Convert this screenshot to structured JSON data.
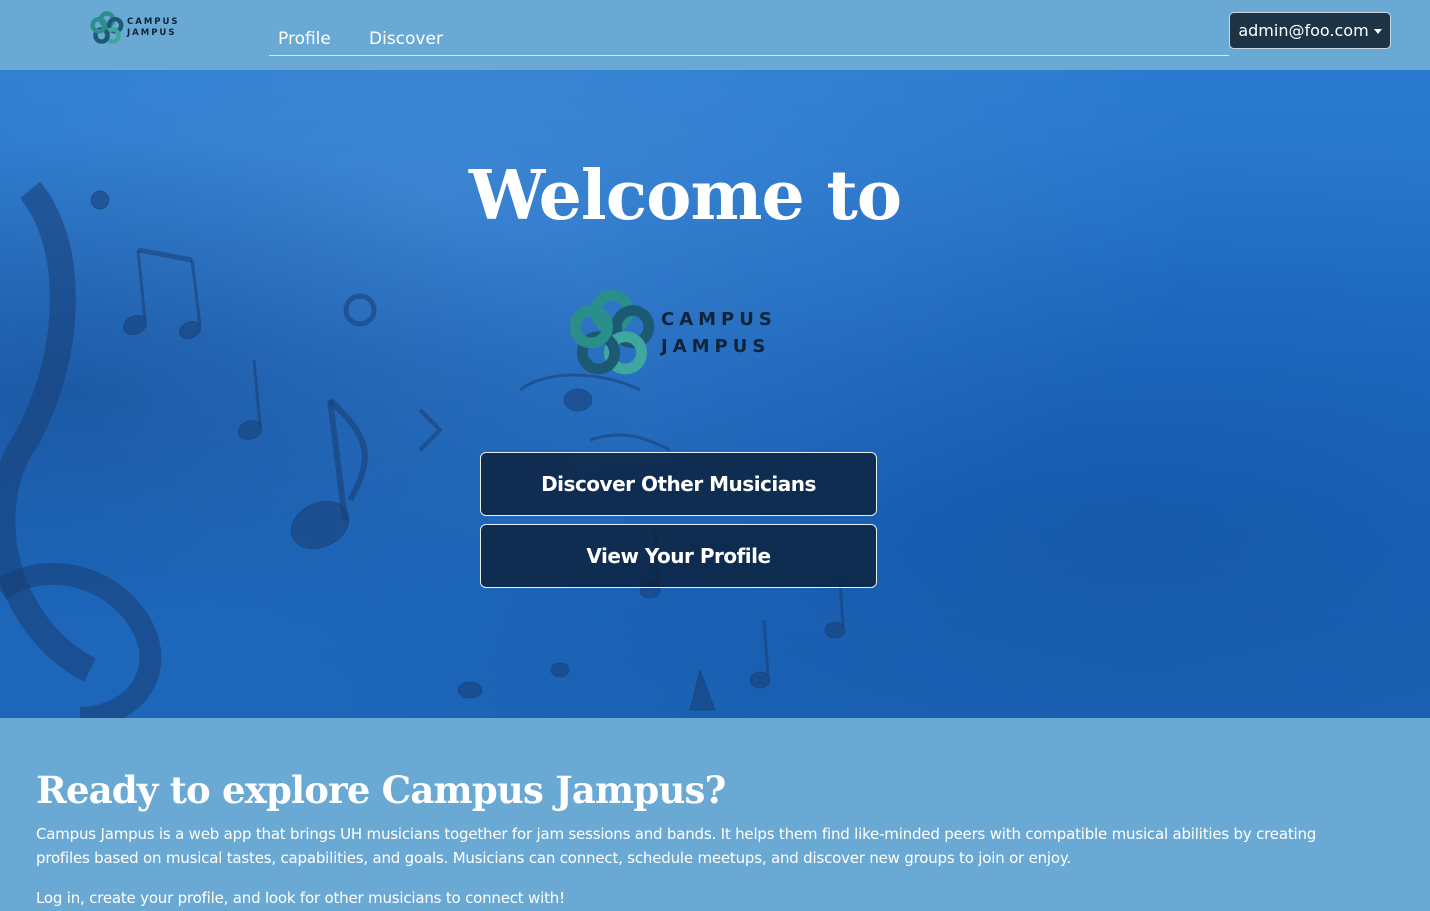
{
  "navbar": {
    "brand_line1": "CAMPUS",
    "brand_line2": "JAMPUS",
    "links": [
      "Profile",
      "Discover"
    ],
    "user_label": "admin@foo.com"
  },
  "hero": {
    "welcome": "Welcome to",
    "logo_line1": "CAMPUS",
    "logo_line2": "JAMPUS",
    "discover_button": "Discover Other Musicians",
    "profile_button": "View Your Profile"
  },
  "about": {
    "heading": "Ready to explore Campus Jampus?",
    "paragraph1": "Campus Jampus is a web app that brings UH musicians together for jam sessions and bands. It helps them find like-minded peers with compatible musical abilities by creating profiles based on musical tastes, capabilities, and goals. Musicians can connect, schedule meetups, and discover new groups to join or enjoy.",
    "paragraph2": "Log in, create your profile, and look for other musicians to connect with!"
  },
  "colors": {
    "navbar_bg": "#6aa9d4",
    "hero_blue": "#1f6ec6",
    "button_bg": "#0c203a",
    "logo_dark": "#0f2438",
    "logo_teal": "#3fa7a0"
  },
  "icons": [
    "campus-jampus-logo-icon",
    "music-notes-background",
    "caret-down-icon"
  ]
}
